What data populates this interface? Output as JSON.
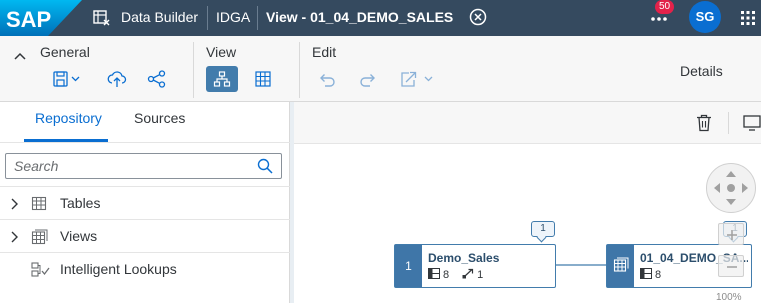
{
  "shell": {
    "logo_text": "SAP",
    "app_title": "Data Builder",
    "space": "IDGA",
    "view_title": "View - 01_04_DEMO_SALES",
    "notification_count": "50",
    "avatar_initials": "SG",
    "colors": {
      "shell_bg": "#354a5f",
      "badge": "#e3224a",
      "avatar": "#0a6ed1"
    }
  },
  "toolbar": {
    "general_label": "General",
    "view_label": "View",
    "edit_label": "Edit",
    "details_label": "Details",
    "icons": [
      "save-icon",
      "deploy-icon",
      "share-icon",
      "graph-view-icon",
      "table-view-icon",
      "undo-icon",
      "redo-icon",
      "export-icon"
    ]
  },
  "left_panel": {
    "tabs": [
      {
        "label": "Repository",
        "selected": true
      },
      {
        "label": "Sources",
        "selected": false
      }
    ],
    "search_placeholder": "Search",
    "tree": [
      {
        "label": "Tables",
        "icon": "table-icon"
      },
      {
        "label": "Views",
        "icon": "view-icon"
      },
      {
        "label": "Intelligent Lookups",
        "icon": "lookup-icon"
      }
    ]
  },
  "canvas": {
    "nodes": [
      {
        "index": "1",
        "title": "Demo_Sales",
        "columns": "8",
        "associations": "1",
        "bubble": "1"
      },
      {
        "title": "01_04_DEMO_SA...",
        "columns": "8",
        "bubble": "1"
      }
    ],
    "zoom": "100%"
  }
}
